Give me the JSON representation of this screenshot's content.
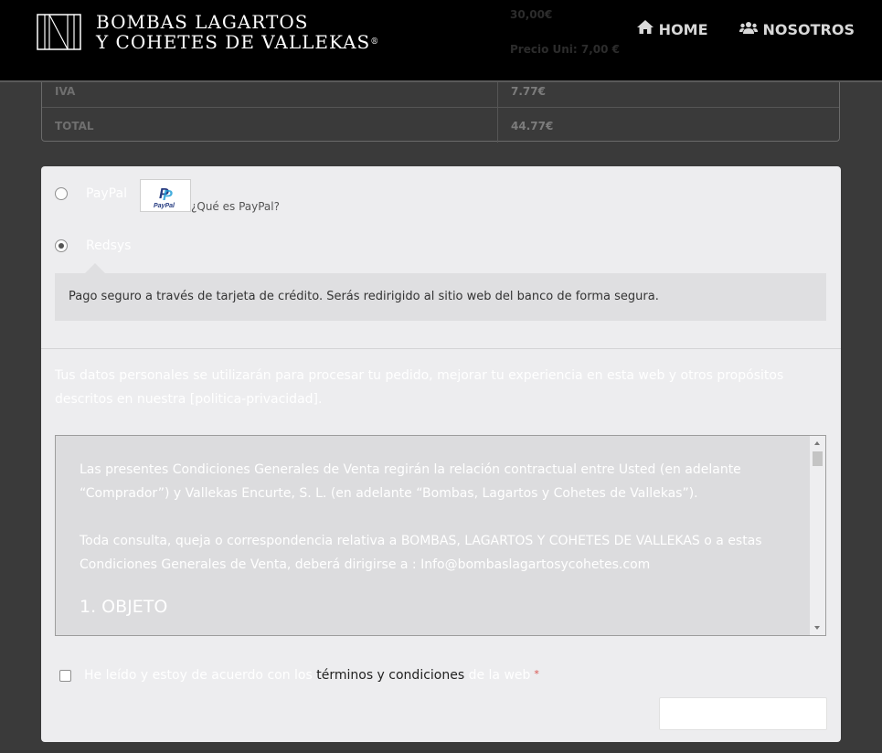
{
  "header": {
    "logo_line1": "BOMBAS LAGARTOS",
    "logo_line2": "Y COHETES DE VALLEKAS",
    "logo_mark": "®",
    "ghost_price": "30,00€",
    "ghost_unit_price": "Precio Uni: 7,00 €",
    "nav": [
      {
        "label": "HOME",
        "icon": "home-icon"
      },
      {
        "label": "NOSOTROS",
        "icon": "users-icon"
      }
    ]
  },
  "totals": {
    "rows": [
      {
        "label": "IVA",
        "value": "7.77€"
      },
      {
        "label": "TOTAL",
        "value": "44.77€"
      }
    ]
  },
  "payment": {
    "paypal_label": "PayPal",
    "paypal_logo_text": "PayPal",
    "paypal_link": "¿Qué es PayPal?",
    "redsys_label": "Redsys",
    "redsys_description": "Pago seguro a través de tarjeta de crédito. Serás redirigido al sitio web del banco de forma segura.",
    "selected": "Redsys"
  },
  "privacy_text": "Tus datos personales se utilizarán para procesar tu pedido, mejorar tu experiencia en esta web y otros propósitos descritos en nuestra [politica-privacidad].",
  "terms": {
    "paragraph1": "Las presentes Condiciones Generales de Venta regirán la relación contractual entre Usted (en adelante “Comprador”) y Vallekas Encurte, S. L. (en adelante “Bombas, Lagartos y Cohetes de Vallekas”).",
    "paragraph2_prefix": "Toda consulta, queja o correspondencia relativa a BOMBAS, LAGARTOS Y COHETES DE VALLEKAS o a estas Condiciones Generales de Venta, deberá dirigirse a :",
    "paragraph2_email": "Info@bombaslagartosycohetes.com",
    "heading": "1. OBJETO"
  },
  "accept": {
    "prefix": "He leído y estoy de acuerdo con los",
    "link": "términos y condiciones",
    "suffix": "de la web",
    "required_mark": "*"
  },
  "colors": {
    "header_bg": "#000000",
    "page_bg": "#3a3a3a",
    "card_bg": "#ededef"
  }
}
